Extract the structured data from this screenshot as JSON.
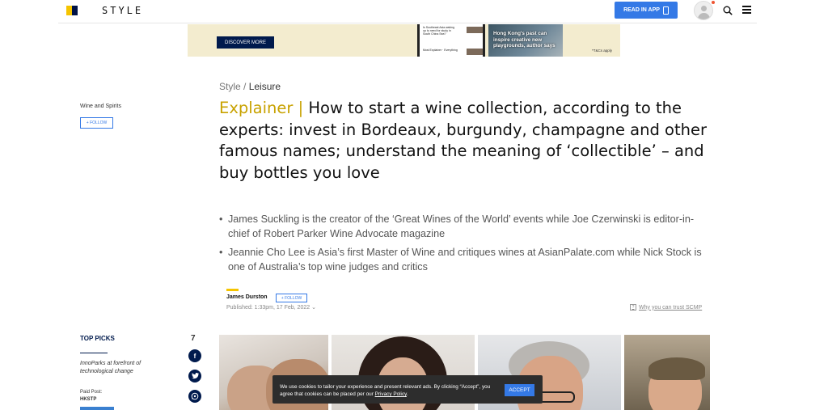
{
  "header": {
    "logo_text": "STYLE",
    "read_in_app": "READ IN APP"
  },
  "ad": {
    "discover": "DISCOVER MORE",
    "mini_1": "Is Southeast Asia waking up to need for study in South China Sea?",
    "mini_2": "Most Explainer · Everything",
    "photo_caption": "Hong Kong's past can inspire creative new playgrounds, author says",
    "tc": "*T&Cs apply"
  },
  "sidebar": {
    "topic": "Wine and Spirits",
    "follow": "+ FOLLOW"
  },
  "article": {
    "breadcrumb_section": "Style /",
    "breadcrumb_sub": "Leisure",
    "headline_label": "Explainer |",
    "headline": "How to start a wine collection, according to the experts: invest in Bordeaux, burgundy, champagne and other famous names; understand the meaning of ‘collectible’ – and buy bottles you love",
    "summary": [
      "James Suckling is the creator of the ‘Great Wines of the World’ events while Joe Czerwinski is editor-in-chief of Robert Parker Wine Advocate magazine",
      "Jeannie Cho Lee is Asia’s first Master of Wine and critiques wines at AsianPalate.com while Nick Stock is one of Australia’s top wine judges and critics"
    ],
    "author": "James Durston",
    "author_follow": "+ FOLLOW",
    "published": "Published: 1:33pm, 17 Feb, 2022",
    "trust": "Why you can trust SCMP"
  },
  "top_picks": {
    "title": "TOP PICKS",
    "item_text": "InnoParks at forefront of technological change",
    "paid_label": "Paid Post:",
    "paid_by": "HKSTP"
  },
  "share": {
    "count": "7",
    "icons": [
      "facebook-icon",
      "twitter-icon",
      "whatsapp-icon"
    ]
  },
  "cookie": {
    "text_1": "We use cookies to tailor your experience and present relevant ads. By clicking “Accept”, you agree that cookies can be placed per our ",
    "policy_link": "Privacy Policy",
    "text_2": ".",
    "accept": "ACCEPT"
  },
  "colors": {
    "brand_yellow": "#f5c400",
    "brand_navy": "#001246",
    "accent_blue": "#3479e6",
    "explainer_gold": "#c8a200"
  }
}
